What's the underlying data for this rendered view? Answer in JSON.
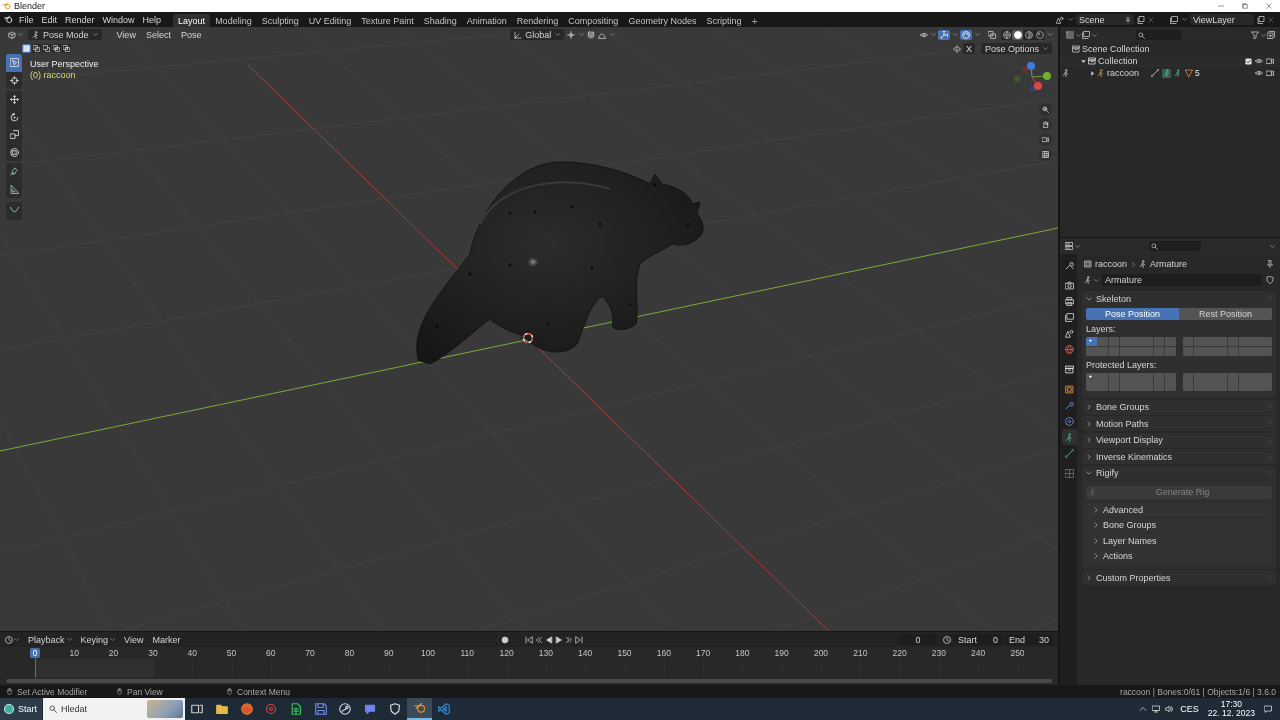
{
  "window": {
    "title": "Blender"
  },
  "menu_bar": {
    "menus": [
      "File",
      "Edit",
      "Render",
      "Window",
      "Help"
    ],
    "workspaces": [
      {
        "label": "Layout",
        "selected": true
      },
      {
        "label": "Modeling",
        "selected": false
      },
      {
        "label": "Sculpting",
        "selected": false
      },
      {
        "label": "UV Editing",
        "selected": false
      },
      {
        "label": "Texture Paint",
        "selected": false
      },
      {
        "label": "Shading",
        "selected": false
      },
      {
        "label": "Animation",
        "selected": false
      },
      {
        "label": "Rendering",
        "selected": false
      },
      {
        "label": "Compositing",
        "selected": false
      },
      {
        "label": "Geometry Nodes",
        "selected": false
      },
      {
        "label": "Scripting",
        "selected": false
      }
    ],
    "add_workspace": "+",
    "scene": "Scene",
    "view_layer": "ViewLayer"
  },
  "viewport": {
    "mode": "Pose Mode",
    "menus": [
      "View",
      "Select",
      "Pose"
    ],
    "orientation": "Global",
    "select_modes": [
      {
        "selected": true
      },
      {
        "selected": false
      },
      {
        "selected": false
      },
      {
        "selected": false
      },
      {
        "selected": false
      }
    ],
    "gizmos": true,
    "overlays": true,
    "shading_modes": [
      {
        "selected": false
      },
      {
        "selected": true
      },
      {
        "selected": false
      },
      {
        "selected": false
      }
    ],
    "mirror_axis": "X",
    "pose_options": "Pose Options",
    "view_name": "User Perspective",
    "object_info": "(0) raccoon",
    "tools": [
      {
        "selected": true
      },
      {
        "selected": false
      },
      {
        "selected": false
      },
      {
        "selected": false
      },
      {
        "selected": false
      },
      {
        "selected": false
      },
      {
        "selected": false
      },
      {
        "selected": false
      },
      {
        "selected": false
      }
    ]
  },
  "outliner": {
    "tree": [
      {
        "kind": "scene_collection",
        "label": "Scene Collection",
        "children": [
          {
            "kind": "collection",
            "label": "Collection",
            "expanded": true,
            "checked": true,
            "children": [
              {
                "kind": "armature",
                "label": "raccoon",
                "expanded": false,
                "child_count": "5"
              }
            ]
          }
        ]
      }
    ]
  },
  "properties": {
    "tabs": [
      {
        "selected": false
      },
      {
        "selected": false
      },
      {
        "selected": false
      },
      {
        "selected": false
      },
      {
        "selected": false
      },
      {
        "selected": false
      },
      {
        "selected": false
      },
      {
        "selected": false
      },
      {
        "selected": false
      },
      {
        "selected": false
      },
      {
        "selected": true
      },
      {
        "selected": false
      },
      {
        "selected": false
      }
    ],
    "breadcrumb": [
      "raccoon",
      "Armature"
    ],
    "datablock": "Armature",
    "panels": [
      {
        "title": "Skeleton",
        "expanded": true,
        "positions": [
          {
            "label": "Pose Position",
            "selected": true
          },
          {
            "label": "Rest Position",
            "selected": false
          }
        ],
        "layer_groups": [
          {
            "label": "Layers:",
            "blocks": [
              [
                {
                  "selected": true,
                  "has_bones": true
                },
                {
                  "selected": false,
                  "has_bones": false
                },
                {
                  "selected": false,
                  "has_bones": false
                },
                {
                  "selected": false,
                  "has_bones": false
                },
                {
                  "selected": false,
                  "has_bones": false
                },
                {
                  "selected": false,
                  "has_bones": false
                },
                {
                  "selected": false,
                  "has_bones": false
                },
                {
                  "selected": false,
                  "has_bones": false
                },
                {
                  "selected": false,
                  "has_bones": false
                },
                {
                  "selected": false,
                  "has_bones": false
                },
                {
                  "selected": false,
                  "has_bones": false
                },
                {
                  "selected": false,
                  "has_bones": false
                },
                {
                  "selected": false,
                  "has_bones": false
                },
                {
                  "selected": false,
                  "has_bones": false
                },
                {
                  "selected": false,
                  "has_bones": false
                },
                {
                  "selected": false,
                  "has_bones": false
                }
              ],
              [
                {
                  "selected": false,
                  "has_bones": false
                },
                {
                  "selected": false,
                  "has_bones": false
                },
                {
                  "selected": false,
                  "has_bones": false
                },
                {
                  "selected": false,
                  "has_bones": false
                },
                {
                  "selected": false,
                  "has_bones": false
                },
                {
                  "selected": false,
                  "has_bones": false
                },
                {
                  "selected": false,
                  "has_bones": false
                },
                {
                  "selected": false,
                  "has_bones": false
                },
                {
                  "selected": false,
                  "has_bones": false
                },
                {
                  "selected": false,
                  "has_bones": false
                },
                {
                  "selected": false,
                  "has_bones": false
                },
                {
                  "selected": false,
                  "has_bones": false
                },
                {
                  "selected": false,
                  "has_bones": false
                },
                {
                  "selected": false,
                  "has_bones": false
                },
                {
                  "selected": false,
                  "has_bones": false
                },
                {
                  "selected": false,
                  "has_bones": false
                }
              ]
            ]
          },
          {
            "label": "Protected Layers:",
            "blocks": [
              [
                {
                  "selected": false,
                  "has_bones": true
                },
                {
                  "selected": false,
                  "has_bones": false
                },
                {
                  "selected": false,
                  "has_bones": false
                },
                {
                  "selected": false,
                  "has_bones": false
                },
                {
                  "selected": false,
                  "has_bones": false
                },
                {
                  "selected": false,
                  "has_bones": false
                },
                {
                  "selected": false,
                  "has_bones": false
                },
                {
                  "selected": false,
                  "has_bones": false
                },
                {
                  "selected": false,
                  "has_bones": false
                },
                {
                  "selected": false,
                  "has_bones": false
                },
                {
                  "selected": false,
                  "has_bones": false
                },
                {
                  "selected": false,
                  "has_bones": false
                },
                {
                  "selected": false,
                  "has_bones": false
                },
                {
                  "selected": false,
                  "has_bones": false
                },
                {
                  "selected": false,
                  "has_bones": false
                },
                {
                  "selected": false,
                  "has_bones": false
                }
              ],
              [
                {
                  "selected": false,
                  "has_bones": false
                },
                {
                  "selected": false,
                  "has_bones": false
                },
                {
                  "selected": false,
                  "has_bones": false
                },
                {
                  "selected": false,
                  "has_bones": false
                },
                {
                  "selected": false,
                  "has_bones": false
                },
                {
                  "selected": false,
                  "has_bones": false
                },
                {
                  "selected": false,
                  "has_bones": false
                },
                {
                  "selected": false,
                  "has_bones": false
                },
                {
                  "selected": false,
                  "has_bones": false
                },
                {
                  "selected": false,
                  "has_bones": false
                },
                {
                  "selected": false,
                  "has_bones": false
                },
                {
                  "selected": false,
                  "has_bones": false
                },
                {
                  "selected": false,
                  "has_bones": false
                },
                {
                  "selected": false,
                  "has_bones": false
                },
                {
                  "selected": false,
                  "has_bones": false
                },
                {
                  "selected": false,
                  "has_bones": false
                }
              ]
            ]
          }
        ]
      },
      {
        "title": "Bone Groups",
        "expanded": false
      },
      {
        "title": "Motion Paths",
        "expanded": false
      },
      {
        "title": "Viewport Display",
        "expanded": false
      },
      {
        "title": "Inverse Kinematics",
        "expanded": false
      },
      {
        "title": "Rigify",
        "expanded": true,
        "button": {
          "label": "Generate Rig",
          "disabled": true
        },
        "subpanels": [
          {
            "title": "Advanced",
            "expanded": false
          },
          {
            "title": "Bone Groups",
            "expanded": false
          },
          {
            "title": "Layer Names",
            "expanded": false
          },
          {
            "title": "Actions",
            "expanded": false
          }
        ]
      },
      {
        "title": "Custom Properties",
        "expanded": false
      }
    ]
  },
  "timeline": {
    "menus": [
      {
        "label": "Playback",
        "dropdown": true
      },
      {
        "label": "Keying",
        "dropdown": true
      },
      {
        "label": "View",
        "dropdown": false
      },
      {
        "label": "Marker",
        "dropdown": false
      }
    ],
    "auto_keying": false,
    "current_frame": "0",
    "start_label": "Start",
    "start": "0",
    "end_label": "End",
    "end": "30",
    "playhead": "0",
    "ruler": [
      "10",
      "20",
      "30",
      "40",
      "50",
      "60",
      "70",
      "80",
      "90",
      "100",
      "110",
      "120",
      "130",
      "140",
      "150",
      "160",
      "170",
      "180",
      "190",
      "200",
      "210",
      "220",
      "230",
      "240",
      "250"
    ]
  },
  "status_bar": {
    "hints": [
      "Set Active Modifier",
      "Pan View",
      "Context Menu"
    ],
    "stats": "raccoon | Bones:0/61 | Objects:1/6 | 3.6.0"
  },
  "taskbar": {
    "start": "Start",
    "search": {
      "placeholder": "Hledat"
    },
    "apps": [
      {
        "selected": false
      },
      {
        "selected": false
      },
      {
        "selected": false
      },
      {
        "selected": false
      },
      {
        "selected": false
      },
      {
        "selected": false
      },
      {
        "selected": false
      },
      {
        "selected": false
      },
      {
        "selected": false
      },
      {
        "selected": true
      },
      {
        "selected": false
      }
    ],
    "language": "CES",
    "time": "17:30",
    "date": "22. 12. 2023"
  }
}
